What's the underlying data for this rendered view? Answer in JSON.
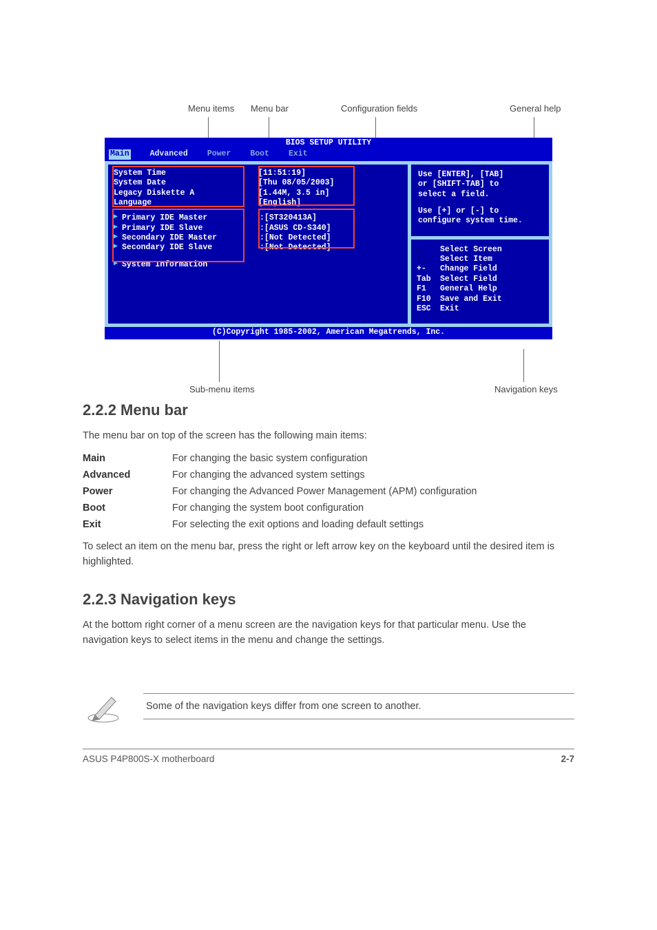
{
  "bios": {
    "title": "BIOS SETUP UTILITY",
    "menu": [
      "Main",
      "Advanced",
      "Power",
      "Boot",
      "Exit"
    ],
    "menu_selected": 0,
    "fields": [
      {
        "label": "System Time",
        "value": "[11:51:19]"
      },
      {
        "label": "System Date",
        "value": "[Thu 08/05/2003]"
      },
      {
        "label": "Legacy Diskette A",
        "value": "[1.44M, 3.5 in]"
      },
      {
        "label": "Language",
        "value": "[English]"
      }
    ],
    "submenu": [
      {
        "label": "Primary IDE Master",
        "value": ":[ST320413A]"
      },
      {
        "label": "Primary IDE Slave",
        "value": ":[ASUS CD-S340]"
      },
      {
        "label": "Secondary IDE Master",
        "value": ":[Not Detected]"
      },
      {
        "label": "Secondary IDE Slave",
        "value": ":[Not Detected]"
      }
    ],
    "sysinfo": "System Information",
    "help_top": [
      "Use [ENTER], [TAB]",
      "or [SHIFT-TAB] to",
      "select a field.",
      "",
      "Use [+] or [-] to",
      "configure system time."
    ],
    "help_keys": [
      {
        "key": "←",
        "desc": "Select Screen"
      },
      {
        "key": "↑↓",
        "desc": "Select Item"
      },
      {
        "key": "+-",
        "desc": "Change Field"
      },
      {
        "key": "Tab",
        "desc": "Select Field"
      },
      {
        "key": "F1",
        "desc": "General Help"
      },
      {
        "key": "F10",
        "desc": "Save and Exit"
      },
      {
        "key": "ESC",
        "desc": "Exit"
      }
    ],
    "copyright": "(C)Copyright 1985-2002, American Megatrends, Inc."
  },
  "callouts": {
    "menu_items": "Menu items",
    "menu_bar": "Menu bar",
    "config_fields": "Configuration fields",
    "general_help": "General help",
    "submenu_items": "Sub-menu items",
    "nav_keys": "Navigation keys"
  },
  "doc": {
    "section_title": "2.2.2  Menu bar",
    "intro": "The menu bar on top of the screen has the following main items:",
    "items": [
      {
        "name": "Main",
        "desc": "For changing the basic system configuration"
      },
      {
        "name": "Advanced",
        "desc": "For changing the advanced system settings"
      },
      {
        "name": "Power",
        "desc": "For changing the Advanced Power Management (APM) configuration"
      },
      {
        "name": "Boot",
        "desc": "For changing the system boot configuration"
      },
      {
        "name": "Exit",
        "desc": "For selecting the exit options and loading default settings"
      }
    ],
    "para2": "To select an item on the menu bar, press the right or left arrow key on the keyboard until the desired item is highlighted.",
    "section_title2": "2.2.3  Navigation keys",
    "para3_a": "At the bottom right corner of a menu screen are the navigation keys for that particular menu. Use the navigation keys to select items in the menu and change the settings.",
    "note": "Some of the navigation keys differ from one screen to another.",
    "footer_left": "ASUS P4P800S-X motherboard",
    "footer_right": "2-7"
  }
}
